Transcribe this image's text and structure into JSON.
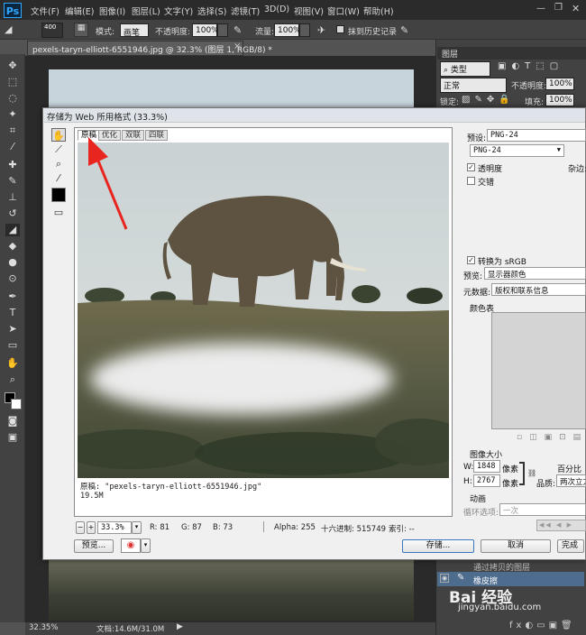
{
  "app": {
    "logo": "Ps",
    "menu": [
      "文件(F)",
      "编辑(E)",
      "图像(I)",
      "图层(L)",
      "文字(Y)",
      "选择(S)",
      "滤镜(T)",
      "3D(D)",
      "视图(V)",
      "窗口(W)",
      "帮助(H)"
    ]
  },
  "options": {
    "brush_size": "400",
    "mode_label": "模式:",
    "mode_value": "画笔",
    "opacity_label": "不透明度:",
    "opacity_value": "100%",
    "flow_label": "流量:",
    "flow_value": "100%",
    "erase_history": "抹到历史记录"
  },
  "document": {
    "tab": "pexels-taryn-elliott-6551946.jpg @ 32.3% (图层 1, RGB/8) *",
    "close": "×",
    "zoom": "32.35%",
    "doc_size": "文档:14.6M/31.0M"
  },
  "layers_panel": {
    "tab": "图层",
    "filter": "类型",
    "blend_mode": "正常",
    "opacity_label": "不透明度:",
    "opacity_value": "100%",
    "lock_label": "锁定:",
    "fill_label": "填充:",
    "fill_value": "100%",
    "layer_item_partial": "通过拷贝的图层",
    "layer_item": "橡皮擦"
  },
  "dialog": {
    "title": "存储为 Web 所用格式 (33.3%)",
    "tabs": [
      "原稿",
      "优化",
      "双联",
      "四联"
    ],
    "caption_filename": "原稿: \"pexels-taryn-elliott-6551946.jpg\"",
    "caption_size": "19.5M",
    "zoom": "33.3%",
    "status": {
      "r": "R: 81",
      "g": "G: 87",
      "b": "B: 73",
      "alpha": "Alpha: 255",
      "hex": "十六进制: 515749",
      "index": "索引: --"
    },
    "preview_button": "预览...",
    "save_button": "存储...",
    "cancel_button": "取消",
    "done_button": "完成",
    "preset_label": "预设:",
    "preset_value": "PNG-24",
    "format_value": "PNG-24",
    "transparency": "透明度",
    "matte_label": "杂边:",
    "interlaced": "交错",
    "convert_srgb": "转换为 sRGB",
    "preview_label": "预览:",
    "preview_value": "显示器颜色",
    "metadata_label": "元数据:",
    "metadata_value": "版权和联系信息",
    "color_table": "颜色表",
    "image_size": "图像大小",
    "w_label": "W:",
    "w_value": "1848",
    "h_label": "H:",
    "h_value": "2767",
    "px_unit": "像素",
    "percent_label": "百分比",
    "quality_label": "品质:",
    "quality_value": "两次立方",
    "animation": "动画",
    "loop_label": "循环选项:",
    "loop_value": "一次"
  },
  "watermark": {
    "brand": "Bai 经验",
    "url": "jingyan.baidu.com"
  }
}
